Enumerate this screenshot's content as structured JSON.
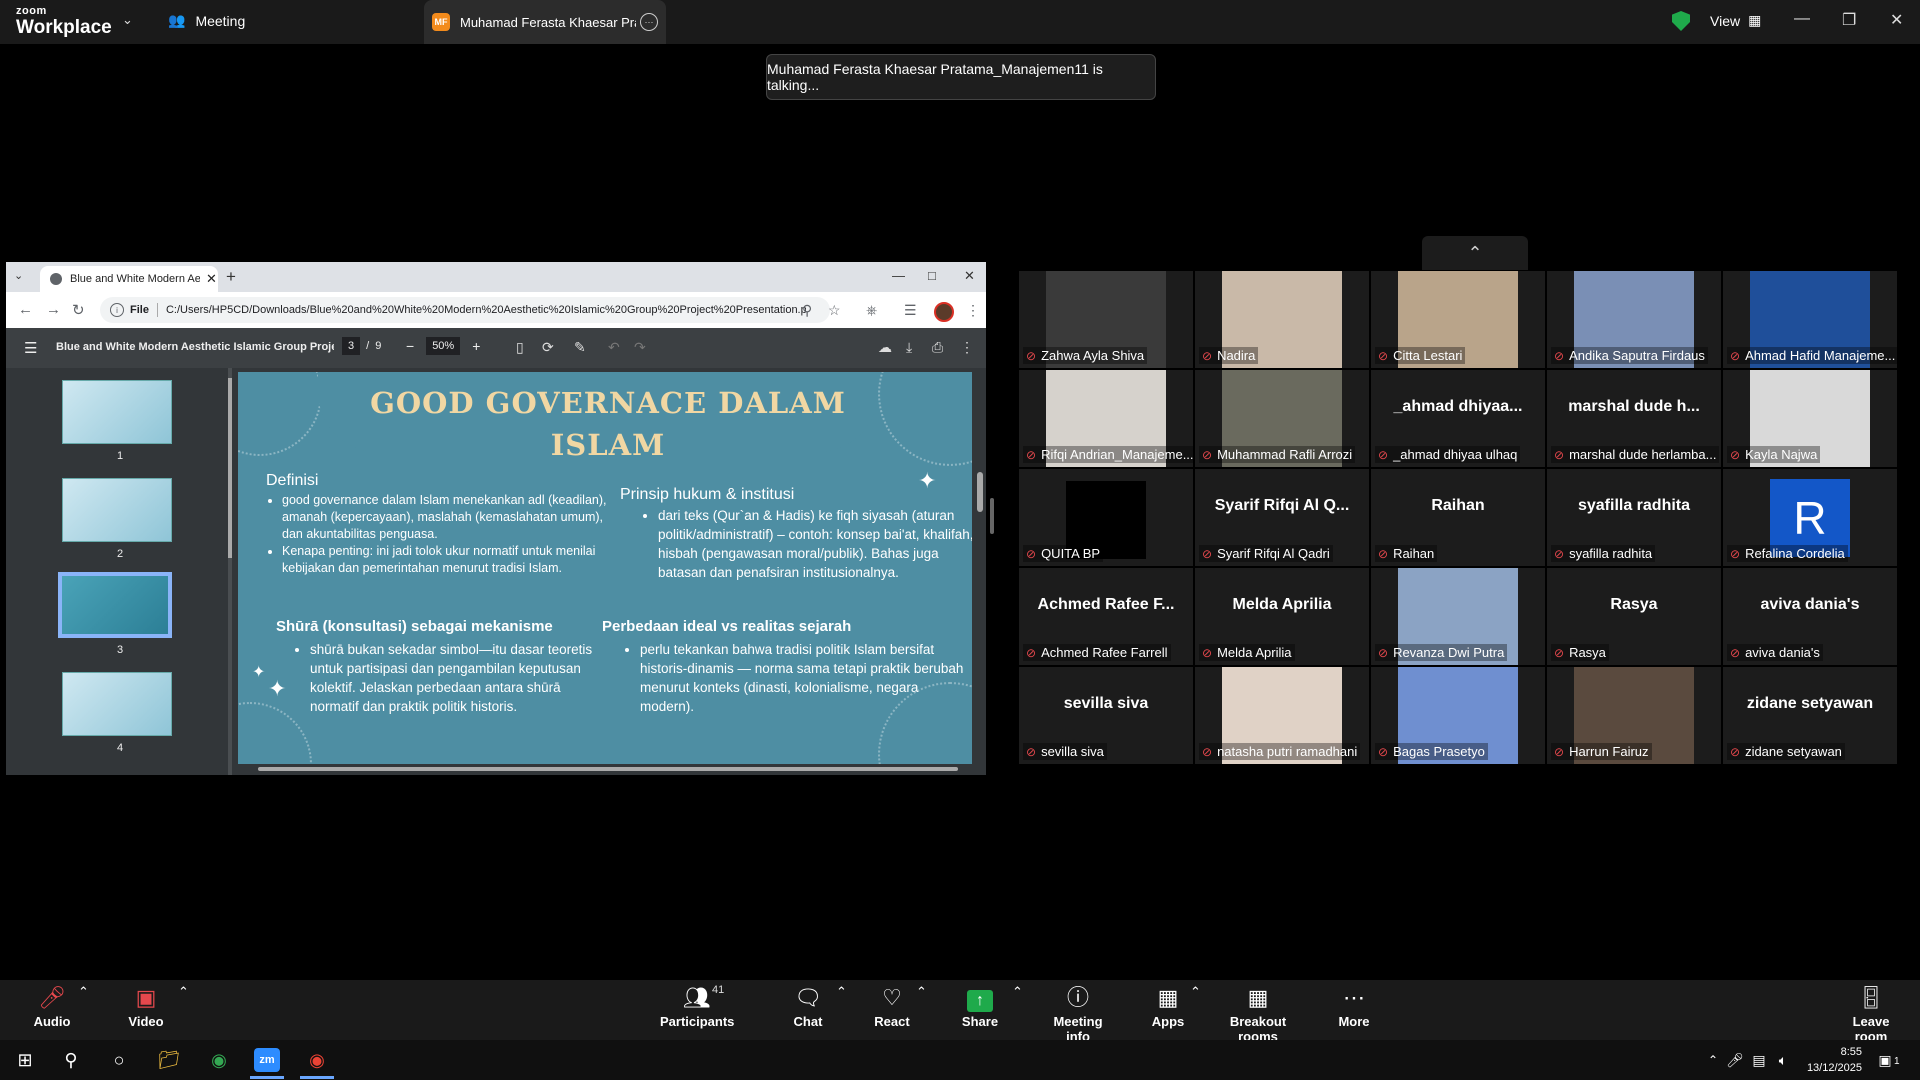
{
  "zoom": {
    "logo_top": "zoom",
    "logo_bottom": "Workplace",
    "tab_meeting": "Meeting",
    "tab_active_initials": "MF",
    "tab_active_title": "Muhamad Ferasta Khaesar Pratama_Manajemen11",
    "view_label": "View",
    "talking": "Muhamad Ferasta Khaesar Pratama_Manajemen11 is talking..."
  },
  "browser": {
    "tab_title": "Blue and White Modern Aesthetic Islamic Group Project",
    "url_scheme": "File",
    "url": "C:/Users/HP5CD/Downloads/Blue%20and%20White%20Modern%20Aesthetic%20Islamic%20Group%20Project%20Presentation.pdf",
    "pdf_title": "Blue and White Modern Aesthetic Islamic Group Proje...",
    "page_current": "3",
    "page_sep": "/",
    "page_total": "9",
    "zoom_level": "50%",
    "thumbs": [
      "1",
      "2",
      "3",
      "4"
    ]
  },
  "slide": {
    "title_line1": "GOOD GOVERNACE DALAM",
    "title_line2": "ISLAM",
    "def_heading": "Definisi",
    "def_items": [
      "good governance dalam Islam menekankan adl (keadilan), amanah (kepercayaan), maslahah (kemaslahatan umum), dan akuntabilitas penguasa.",
      "Kenapa penting: ini jadi tolok ukur normatif untuk menilai kebijakan dan pemerintahan menurut tradisi Islam."
    ],
    "prinsip_heading": "Prinsip hukum & institusi",
    "prinsip_items": [
      "dari teks (Qur`an & Hadis) ke fiqh siyasah (aturan politik/administratif) – contoh: konsep bai'at, khalifah, hisbah (pengawasan moral/publik). Bahas juga batasan dan penafsiran institusionalnya."
    ],
    "shura_heading": "Shūrā (konsultasi) sebagai mekanisme",
    "shura_items": [
      "shūrā bukan sekadar simbol—itu dasar teoretis untuk partisipasi dan pengambilan keputusan kolektif. Jelaskan perbedaan antara shūrā normatif dan praktik politik historis."
    ],
    "beda_heading": "Perbedaan ideal vs realitas sejarah",
    "beda_items": [
      "perlu tekankan bahwa tradisi politik Islam bersifat historis-dinamis — norma sama tetapi praktik berubah menurut konteks (dinasti, kolonialisme, negara modern)."
    ]
  },
  "gallery": [
    {
      "name": "Zahwa Ayla Shiva",
      "video": true,
      "tone": "#3a3a3a"
    },
    {
      "name": "Nadira",
      "video": true,
      "tone": "#c9b9a8"
    },
    {
      "name": "Citta Lestari",
      "video": true,
      "tone": "#b9a48a"
    },
    {
      "name": "Andika Saputra Firdaus",
      "video": true,
      "tone": "#7a8fb5"
    },
    {
      "name": "Ahmad Hafid Manajeme...",
      "video": true,
      "tone": "#1f4f9a"
    },
    {
      "name": "Rifqi Andrian_Manajeme...",
      "video": true,
      "tone": "#d6d2cc"
    },
    {
      "name": "Muhammad Rafli Arrozi",
      "video": true,
      "tone": "#6a6a5e"
    },
    {
      "name": "_ahmad dhiyaa ulhaq",
      "display": "_ahmad dhiyaa...",
      "video": false
    },
    {
      "name": "marshal dude herlamba...",
      "display": "marshal dude h...",
      "video": false
    },
    {
      "name": "Kayla Najwa",
      "video": true,
      "tone": "#d9d9d9"
    },
    {
      "name": "QUITA BP",
      "video": true,
      "tone": "#000000"
    },
    {
      "name": "Syarif Rifqi Al Qadri",
      "display": "Syarif Rifqi Al Q...",
      "video": false
    },
    {
      "name": "Raihan",
      "display": "Raihan",
      "video": false
    },
    {
      "name": "syafilla radhita",
      "display": "syafilla radhita",
      "video": false
    },
    {
      "name": "Refalina Cordelia",
      "avatar": "R",
      "video": false
    },
    {
      "name": "Achmed Rafee Farrell",
      "display": "Achmed Rafee F...",
      "video": false
    },
    {
      "name": "Melda Aprilia",
      "display": "Melda Aprilia",
      "video": false
    },
    {
      "name": "Revanza Dwi Putra",
      "video": true,
      "tone": "#8ba3c4"
    },
    {
      "name": "Rasya",
      "display": "Rasya",
      "video": false
    },
    {
      "name": "aviva dania's",
      "display": "aviva dania's",
      "video": false
    },
    {
      "name": "sevilla siva",
      "display": "sevilla siva",
      "video": false
    },
    {
      "name": "natasha putri ramadhani",
      "video": true,
      "tone": "#e0d2c6"
    },
    {
      "name": "Bagas Prasetyo",
      "video": true,
      "tone": "#6f8fd0"
    },
    {
      "name": "Harrun Fairuz",
      "video": true,
      "tone": "#5a4a3e"
    },
    {
      "name": "zidane setyawan",
      "display": "zidane setyawan",
      "video": false
    }
  ],
  "toolbar": {
    "audio": "Audio",
    "video": "Video",
    "participants": "Participants",
    "participants_count": "41",
    "chat": "Chat",
    "react": "React",
    "share": "Share",
    "meeting_info": "Meeting info",
    "apps": "Apps",
    "breakout": "Breakout rooms",
    "more": "More",
    "leave": "Leave room"
  },
  "taskbar": {
    "time": "8:55",
    "date": "13/12/2025",
    "notif_count": "1"
  },
  "colors": {
    "accent_green": "#1faa4b",
    "mute_red": "#e5484d",
    "slide_bg": "#4e8ea3",
    "title_gold": "#f1d7a3"
  }
}
